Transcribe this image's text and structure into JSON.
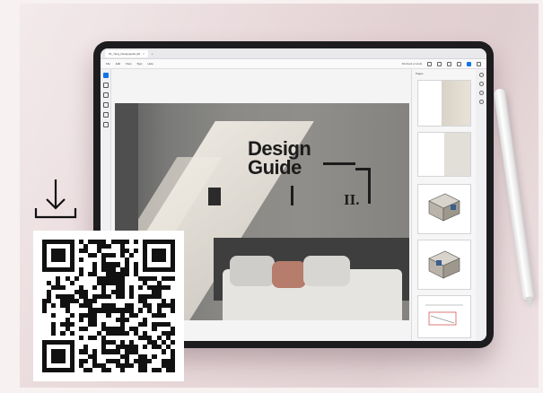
{
  "window": {
    "tab_title": "02_Yang_Designguide.pdf",
    "tab_close": "×",
    "new_tab": "+"
  },
  "menu": {
    "items": [
      "File",
      "Edit",
      "View",
      "Sign",
      "Help"
    ],
    "right_label": "Find text or tools"
  },
  "document": {
    "title_line1": "Design",
    "title_line2": "Guide",
    "roman_numeral": "II."
  },
  "pages_panel": {
    "label": "Pages"
  },
  "icons": {
    "download": "download-icon",
    "qr": "qr-code"
  },
  "colors": {
    "accent": "#1473e6",
    "background": "#ecdfe1",
    "tablet_frame": "#1d1d1f",
    "text_dark": "#1c1c1c"
  }
}
